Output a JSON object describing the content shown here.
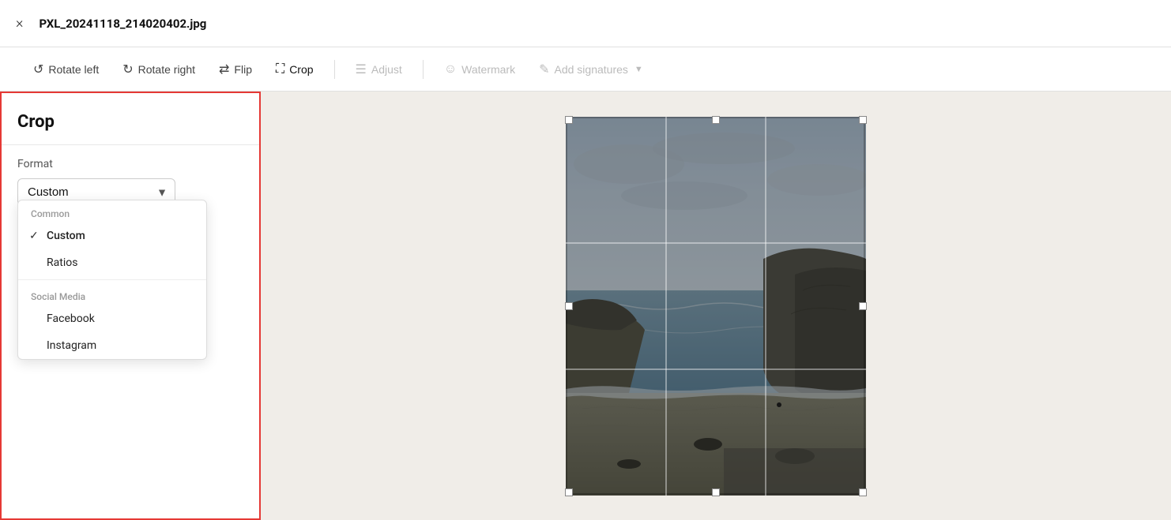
{
  "header": {
    "close_icon": "×",
    "title": "PXL_20241118_214020402.jpg"
  },
  "toolbar": {
    "rotate_left_label": "Rotate left",
    "rotate_right_label": "Rotate right",
    "flip_label": "Flip",
    "crop_label": "Crop",
    "adjust_label": "Adjust",
    "watermark_label": "Watermark",
    "add_signatures_label": "Add signatures"
  },
  "sidebar": {
    "title": "Crop",
    "format_label": "Format",
    "selected_value": "Custom",
    "dropdown": {
      "groups": [
        {
          "label": "Common",
          "items": [
            {
              "value": "Custom",
              "selected": true
            },
            {
              "value": "Ratios",
              "selected": false
            }
          ]
        },
        {
          "label": "Social Media",
          "items": [
            {
              "value": "Facebook",
              "selected": false
            },
            {
              "value": "Instagram",
              "selected": false
            }
          ]
        }
      ]
    }
  },
  "canvas": {
    "image_alt": "Coastal landscape photo"
  }
}
